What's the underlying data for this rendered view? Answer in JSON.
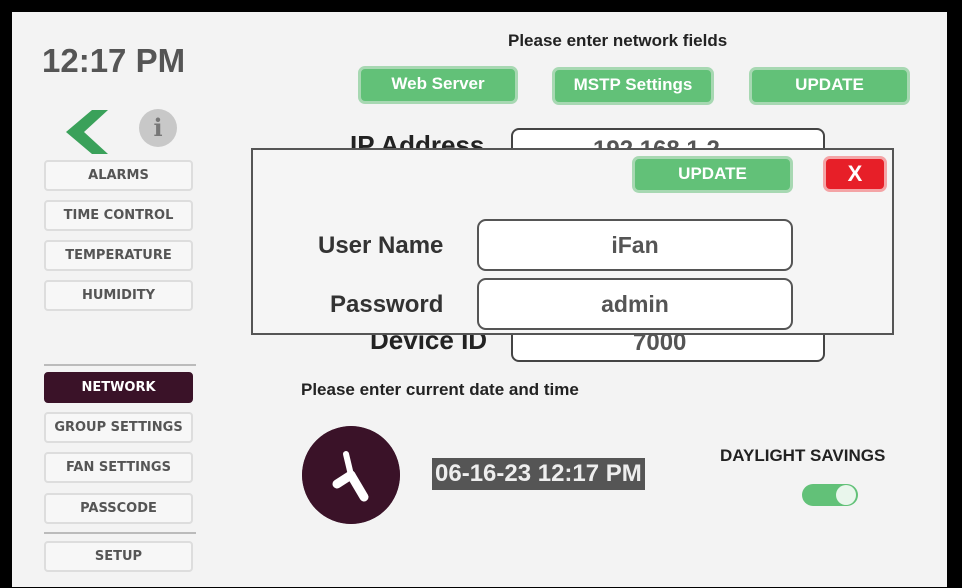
{
  "clock_time": "12:17 PM",
  "sidebar": {
    "info_glyph": "i",
    "items": [
      {
        "label": "ALARMS",
        "active": false
      },
      {
        "label": "TIME CONTROL",
        "active": false
      },
      {
        "label": "TEMPERATURE",
        "active": false
      },
      {
        "label": "HUMIDITY",
        "active": false
      },
      {
        "label": "NETWORK",
        "active": true
      },
      {
        "label": "GROUP SETTINGS",
        "active": false
      },
      {
        "label": "FAN SETTINGS",
        "active": false
      },
      {
        "label": "PASSCODE",
        "active": false
      },
      {
        "label": "SETUP",
        "active": false
      }
    ]
  },
  "network": {
    "title": "Please enter network fields",
    "web_server_label": "Web Server",
    "mstp_label": "MSTP Settings",
    "update_label": "UPDATE",
    "ip_label_partial": "IP Address",
    "ip_value_partial": "192.168.1.2",
    "device_id_label": "Device ID",
    "device_id_value": "7000"
  },
  "datetime": {
    "title": "Please enter current date and time",
    "value": "06-16-23 12:17 PM",
    "dst_label": "DAYLIGHT SAVINGS",
    "dst_on": true
  },
  "modal": {
    "update_label": "UPDATE",
    "close_label": "X",
    "username_label": "User Name",
    "username_value": "iFan",
    "password_label": "Password",
    "password_value": "admin"
  },
  "colors": {
    "accent_green": "#62c178",
    "active_nav": "#3a1228",
    "close_red": "#e71f28"
  }
}
